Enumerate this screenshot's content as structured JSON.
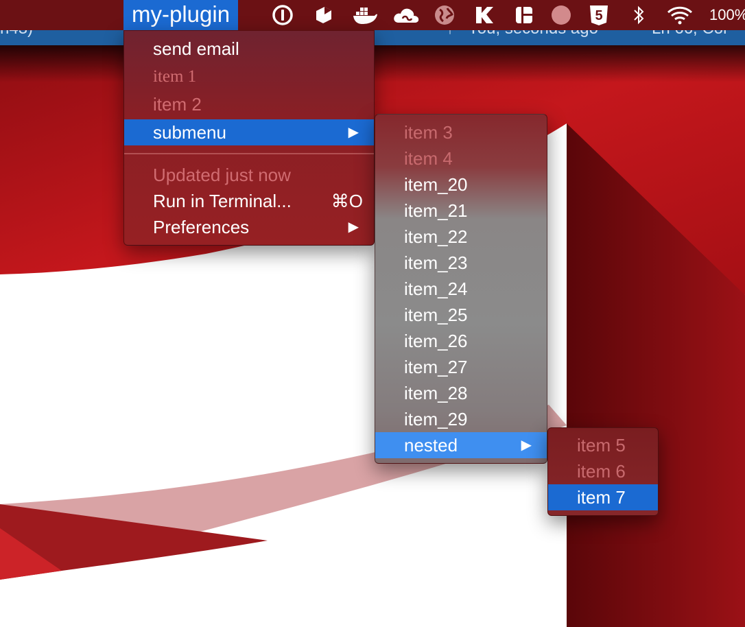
{
  "background_status": {
    "left_fragment": "n43)",
    "commit_text": "You, seconds ago",
    "position_text": "Ln 66, Col"
  },
  "menubar": {
    "plugin_title": "my-plugin",
    "tray_icons": [
      "1password-icon",
      "dropbox-box-icon",
      "docker-icon",
      "creative-cloud-icon",
      "globe-icon",
      "k-app-icon",
      "layout-app-icon",
      "record-dot-icon",
      "html5-shield-icon",
      "bluetooth-icon",
      "wifi-icon"
    ],
    "battery": "100%"
  },
  "main_menu": {
    "send_email": "send email",
    "item1": "item 1",
    "item2": "item 2",
    "submenu": "submenu",
    "updated": "Updated just now",
    "run_terminal": "Run in Terminal...",
    "run_shortcut": "⌘O",
    "preferences": "Preferences"
  },
  "submenu": {
    "items": [
      "item 3",
      "item 4",
      "item_20",
      "item_21",
      "item_22",
      "item_23",
      "item_24",
      "item_25",
      "item_26",
      "item_27",
      "item_28",
      "item_29"
    ],
    "nested": "nested"
  },
  "nested_menu": {
    "items": [
      "item 5",
      "item 6",
      "item 7"
    ]
  },
  "colors": {
    "accent_blue": "#1b6ad2",
    "menubar_bg": "#6b1114",
    "wallpaper_red": "#b9141a"
  }
}
